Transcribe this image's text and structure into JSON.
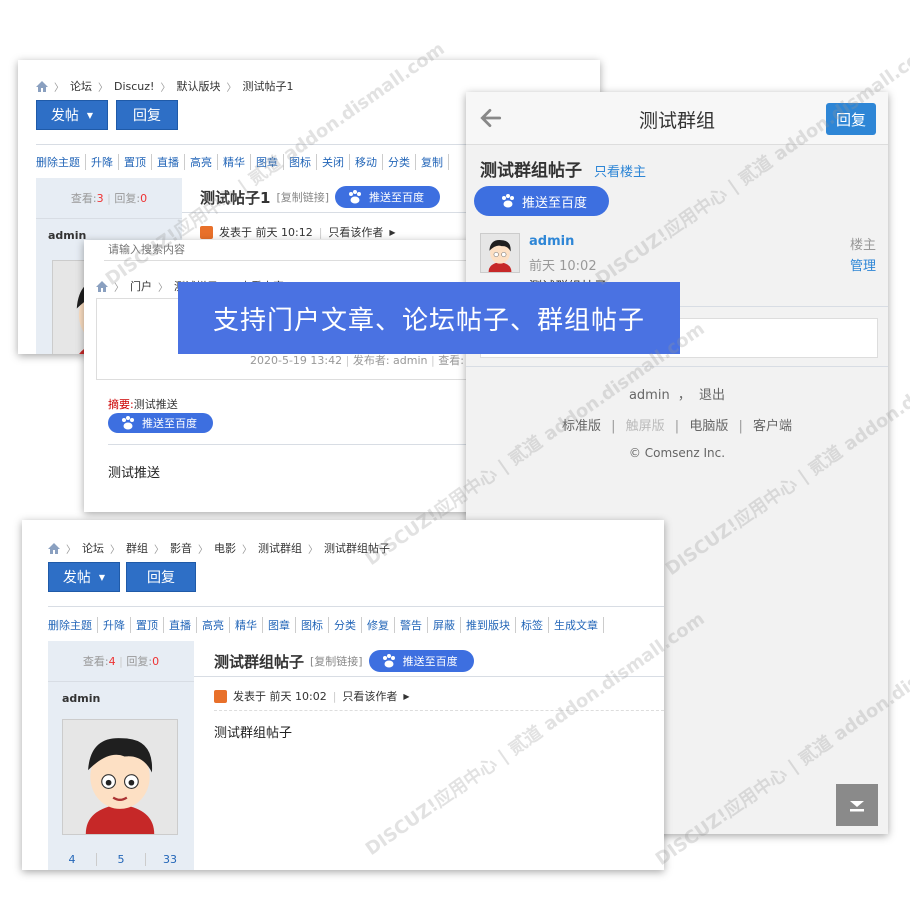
{
  "banner": "支持门户文章、论坛帖子、群组帖子",
  "shot1": {
    "breadcrumb": [
      "论坛",
      "Discuz!",
      "默认版块",
      "测试帖子1"
    ],
    "post_button": "发帖",
    "reply_button": "回复",
    "mod_links": [
      "删除主题",
      "升降",
      "置顶",
      "直播",
      "高亮",
      "精华",
      "图章",
      "图标",
      "关闭",
      "移动",
      "分类",
      "复制"
    ],
    "views_label": "查看:",
    "views": "3",
    "replies_label": "回复:",
    "replies": "0",
    "author": "admin",
    "thread_title": "测试帖子1",
    "copy_link": "[复制链接]",
    "baidu_button": "推送至百度",
    "posted_at": "发表于 前天 10:12",
    "only_author": "只看该作者"
  },
  "shot2": {
    "search_placeholder": "请输入搜索内容",
    "breadcrumb": [
      "门户",
      "测试栏目",
      "查看内容"
    ],
    "meta": "2020-5-19 13:42",
    "publisher": "发布者: admin",
    "views_label": "查看:",
    "summary_label": "摘要:",
    "summary_text": "测试推送",
    "baidu_button": "推送至百度",
    "body_text": "测试推送"
  },
  "mobile": {
    "title": "测试群组",
    "reply_button": "回复",
    "thread_title": "测试群组帖子",
    "only_owner": "只看楼主",
    "baidu_button": "推送至百度",
    "author": "admin",
    "time": "前天 10:02",
    "floor_label": "楼主",
    "manage_label": "管理",
    "post_preview": "测试群组帖子",
    "footer_user": "admin",
    "footer_sep": "，",
    "footer_logout": "退出",
    "versions": [
      "标准版",
      "触屏版",
      "电脑版",
      "客户端"
    ],
    "copyright": "© Comsenz Inc."
  },
  "shot3": {
    "breadcrumb": [
      "论坛",
      "群组",
      "影音",
      "电影",
      "测试群组",
      "测试群组帖子"
    ],
    "post_button": "发帖",
    "reply_button": "回复",
    "mod_links": [
      "删除主题",
      "升降",
      "置顶",
      "直播",
      "高亮",
      "精华",
      "图章",
      "图标",
      "分类",
      "修复",
      "警告",
      "屏蔽",
      "推到版块",
      "标签",
      "生成文章"
    ],
    "views_label": "查看:",
    "views": "4",
    "replies_label": "回复:",
    "replies": "0",
    "author": "admin",
    "thread_title": "测试群组帖子",
    "copy_link": "[复制链接]",
    "baidu_button": "推送至百度",
    "posted_at": "发表于 前天 10:02",
    "only_author": "只看该作者",
    "body_text": "测试群组帖子",
    "stats": [
      "4",
      "5",
      "33"
    ]
  },
  "watermark": "DISCUZ!应用中心 | 贰道  addon.dismall.com",
  "colors": {
    "accent": "#2e6fc6",
    "baidu": "#3d6fe0",
    "banner": "#4a72e2",
    "link": "#2366b8",
    "count_red": "#e33"
  },
  "icons": [
    "home-icon",
    "paw-icon",
    "caret-down-icon",
    "back-arrow-icon",
    "scroll-down-icon",
    "user-edit-icon",
    "play-triangle-icon"
  ]
}
